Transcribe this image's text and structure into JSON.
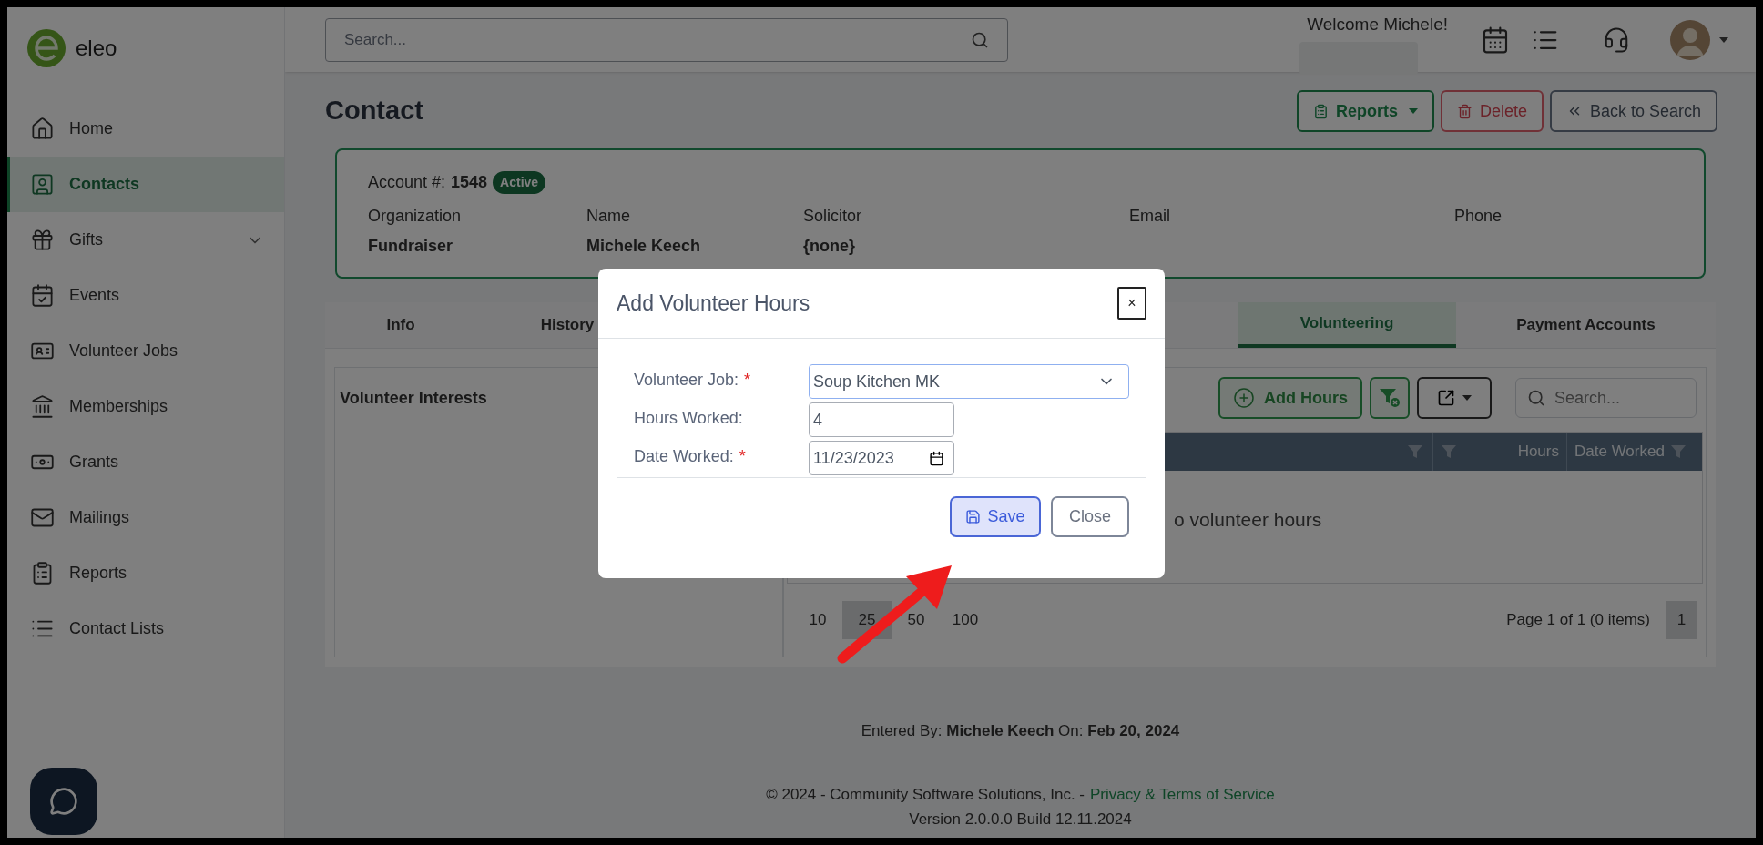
{
  "app": {
    "logo_text": "eleo"
  },
  "sidebar": {
    "items": [
      {
        "label": "Home",
        "selected": false
      },
      {
        "label": "Contacts",
        "selected": true
      },
      {
        "label": "Gifts",
        "selected": false,
        "expanded": false
      },
      {
        "label": "Events",
        "selected": false
      },
      {
        "label": "Volunteer Jobs",
        "selected": false
      },
      {
        "label": "Memberships",
        "selected": false
      },
      {
        "label": "Grants",
        "selected": false
      },
      {
        "label": "Mailings",
        "selected": false
      },
      {
        "label": "Reports",
        "selected": false
      },
      {
        "label": "Contact Lists",
        "selected": false
      }
    ]
  },
  "header": {
    "search_placeholder": "Search...",
    "welcome": "Welcome Michele!"
  },
  "page": {
    "title": "Contact",
    "actions": [
      {
        "label": "Reports",
        "kind": "reports"
      },
      {
        "label": "Delete",
        "kind": "delete"
      },
      {
        "label": "Back to Search",
        "kind": "back"
      }
    ]
  },
  "contact": {
    "account_label": "Account #:",
    "account_number": "1548",
    "status": "Active",
    "fields": [
      {
        "label": "Organization",
        "value": "Fundraiser"
      },
      {
        "label": "Name",
        "value": "Michele Keech"
      },
      {
        "label": "Solicitor",
        "value": "{none}"
      },
      {
        "label": "Email"
      },
      {
        "label": "Phone"
      }
    ]
  },
  "tabs": [
    {
      "label": "Info",
      "selected": false
    },
    {
      "label": "History",
      "selected": false
    },
    {
      "label": "Volunteering",
      "selected": true
    },
    {
      "label": "Payment Accounts",
      "selected": false
    }
  ],
  "volunteer_interests": {
    "title": "Volunteer Interests"
  },
  "grid": {
    "add_label": "Add Hours",
    "search_placeholder": "Search...",
    "columns": [
      {
        "label": "Hours"
      },
      {
        "label": "Date Worked"
      }
    ],
    "empty_text": "o volunteer hours",
    "page_sizes": [
      {
        "label": "10",
        "selected": false
      },
      {
        "label": "25",
        "selected": true
      },
      {
        "label": "50",
        "selected": false
      },
      {
        "label": "100",
        "selected": false
      }
    ],
    "page_info": "Page 1 of 1 (0 items)",
    "pages": [
      {
        "label": "1",
        "selected": true
      }
    ]
  },
  "modal": {
    "title": "Add Volunteer Hours",
    "close": "×",
    "required_mark": "*",
    "fields": [
      {
        "label": "Volunteer Job:",
        "required": true,
        "kind": "select",
        "value": "Soup Kitchen MK"
      },
      {
        "label": "Hours Worked:",
        "required": false,
        "kind": "text",
        "value": "4"
      },
      {
        "label": "Date Worked:",
        "required": true,
        "kind": "date",
        "value": "11/23/2023"
      }
    ],
    "buttons": [
      {
        "label": "Save",
        "kind": "primary"
      },
      {
        "label": "Close",
        "kind": "secondary"
      }
    ]
  },
  "footer": {
    "entered_by": "Entered By: **Michele Keech** On: **Feb 20, 2024**",
    "copyright": "© 2024 - Community Software Solutions, Inc. -",
    "link": "Privacy & Terms of Service",
    "version": "Version 2.0.0.0 Build 12.11.2024"
  }
}
